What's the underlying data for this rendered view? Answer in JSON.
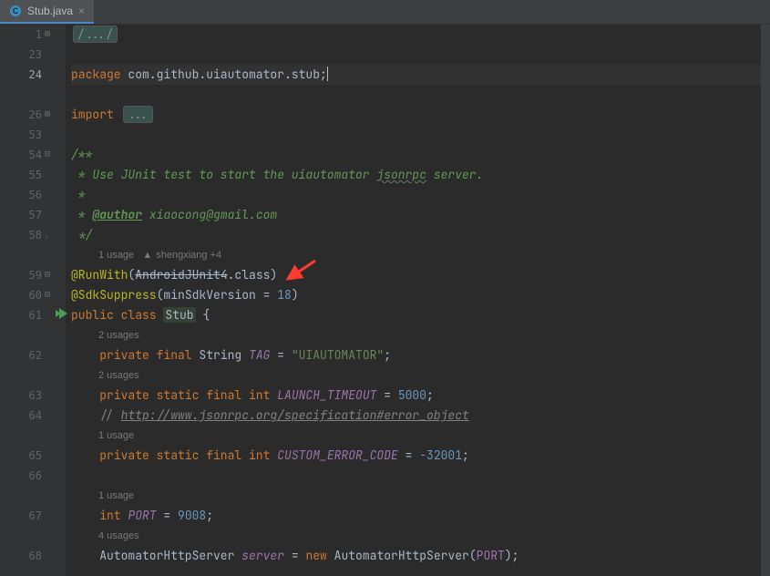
{
  "tab": {
    "filename": "Stub.java"
  },
  "gutter": {
    "lines": [
      {
        "n": "1",
        "fold": "⊞"
      },
      {
        "n": "23"
      },
      {
        "n": "24",
        "current": true
      },
      {
        "n": ""
      },
      {
        "n": "26",
        "fold": "⊞"
      },
      {
        "n": "53"
      },
      {
        "n": "54",
        "fold": "⊟"
      },
      {
        "n": "55"
      },
      {
        "n": "56"
      },
      {
        "n": "57"
      },
      {
        "n": "58",
        "fold": "⌞"
      },
      {
        "n": ""
      },
      {
        "n": "59",
        "fold": "⊟"
      },
      {
        "n": "60",
        "fold": "⊟"
      },
      {
        "n": "61",
        "run": true
      },
      {
        "n": ""
      },
      {
        "n": "62"
      },
      {
        "n": ""
      },
      {
        "n": "63"
      },
      {
        "n": "64"
      },
      {
        "n": ""
      },
      {
        "n": "65"
      },
      {
        "n": "66"
      },
      {
        "n": ""
      },
      {
        "n": "67"
      },
      {
        "n": ""
      },
      {
        "n": "68"
      }
    ]
  },
  "code": {
    "fold_collapsed": "...",
    "line1_fold": "/.../",
    "pkg_kw": "package ",
    "pkg_name": "com.github.uiautomator.stub",
    "semi": ";",
    "import_kw": "import ",
    "doc_open": "/**",
    "doc_l1": " * Use JUnit test to start the uiautomator ",
    "doc_l1_wavy": "jsonrpc",
    "doc_l1_tail": " server.",
    "doc_l2": " *",
    "doc_l3_lead": " * ",
    "doc_l3_tag": "@author",
    "doc_l3_val": " xiaocong@gmail.com",
    "doc_close": " */",
    "inlay_usage1": "1 usage",
    "inlay_author": "shengxiang +4",
    "runwith_a": "@RunWith",
    "runwith_open": "(",
    "runwith_cls": "AndroidJUnit4",
    "runwith_tail": ".class)",
    "sdk_a": "@SdkSuppress",
    "sdk_open": "(",
    "sdk_param": "minSdkVersion ",
    "sdk_eq": "= ",
    "sdk_val": "18",
    "sdk_close": ")",
    "cls_mod": "public class ",
    "cls_name": "Stub",
    "cls_open": " {",
    "inlay_usages2a": "2 usages",
    "tag_mod": "private final ",
    "tag_type": "String ",
    "tag_name": "TAG",
    "tag_eq": " = ",
    "tag_val": "\"UIAUTOMATOR\"",
    "inlay_usages2b": "2 usages",
    "lt_mod": "private static final int ",
    "lt_name": "LAUNCH_TIMEOUT",
    "lt_eq": " = ",
    "lt_val": "5000",
    "comment_slash": "// ",
    "comment_link": "http://www.jsonrpc.org/specification#error_object",
    "inlay_usage1b": "1 usage",
    "ce_mod": "private static final int ",
    "ce_name": "CUSTOM_ERROR_CODE",
    "ce_eq": " = ",
    "ce_val": "-32001",
    "inlay_usage1c": "1 usage",
    "port_mod": "int ",
    "port_name": "PORT",
    "port_eq": " = ",
    "port_val": "9008",
    "inlay_usages4": "4 usages",
    "srv_type": "AutomatorHttpServer ",
    "srv_name": "server",
    "srv_eq": " = ",
    "srv_new": "new ",
    "srv_ctor": "AutomatorHttpServer(",
    "srv_arg": "PORT",
    "srv_close": ");"
  }
}
